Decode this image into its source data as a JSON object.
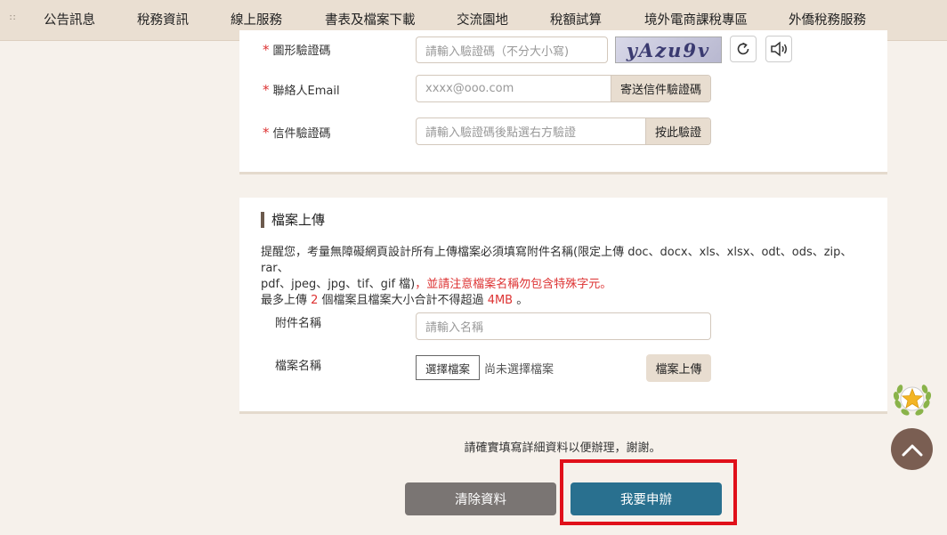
{
  "nav": {
    "items": [
      "公告訊息",
      "稅務資訊",
      "線上服務",
      "書表及檔案下載",
      "交流園地",
      "稅額試算",
      "境外電商課稅專區",
      "外僑稅務服務"
    ]
  },
  "form": {
    "required_mark": "*",
    "captcha": {
      "label": "圖形驗證碼",
      "placeholder": "請輸入驗證碼（不分大小寫)",
      "image_text": "yAzu9v"
    },
    "email": {
      "label": "聯絡人Email",
      "placeholder": "xxxx@ooo.com",
      "button": "寄送信件驗證碼"
    },
    "email_code": {
      "label": "信件驗證碼",
      "placeholder": "請輸入驗證碼後點選右方驗證",
      "button": "按此驗證"
    }
  },
  "upload": {
    "title": "檔案上傳",
    "notice_line1": "提醒您，考量無障礙網頁設計所有上傳檔案必須填寫附件名稱(限定上傳 doc、docx、xls、xlsx、odt、ods、zip、rar、",
    "notice_line2": "pdf、jpeg、jpg、tif、gif 檔)",
    "notice_warning": "，並請注意檔案名稱勿包含特殊字元。",
    "notice_line3_a": "最多上傳 ",
    "max_files": "2",
    "notice_line3_b": " 個檔案且檔案大小合計不得超過 ",
    "max_size": "4MB",
    "notice_line3_c": " 。",
    "attachment_label": "附件名稱",
    "attachment_placeholder": "請輸入名稱",
    "filename_label": "檔案名稱",
    "choose_file": "選擇檔案",
    "no_file": "尚未選擇檔案",
    "upload_button": "檔案上傳"
  },
  "footer": {
    "hint": "請確實填寫詳細資料以便辦理，謝謝。",
    "clear_button": "清除資料",
    "apply_button": "我要申辦"
  },
  "colors": {
    "accent": "#29708f",
    "highlight": "#e0101a",
    "nav_bg": "#eadfd2"
  }
}
